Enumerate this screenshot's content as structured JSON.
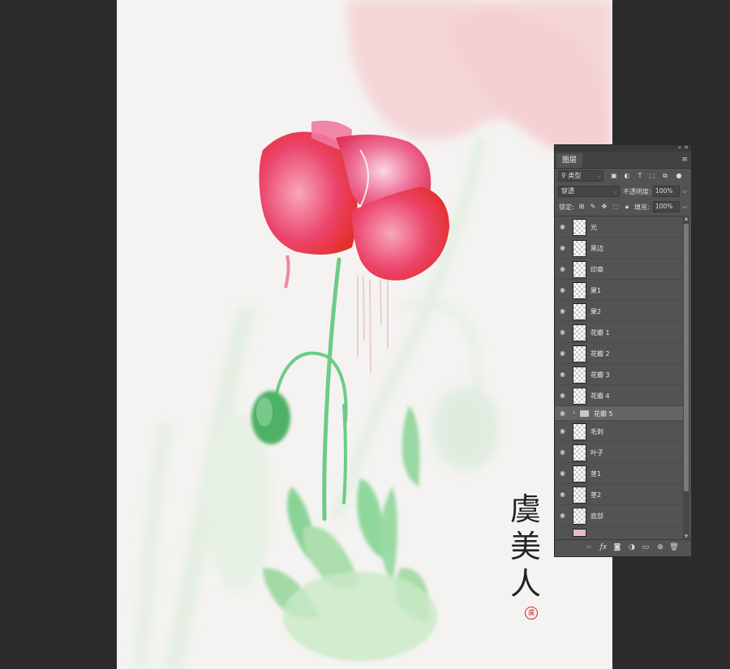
{
  "artwork": {
    "signature": "虞美人",
    "seal": "虞",
    "colors": {
      "paper": "#f4f3f1",
      "petal": "#e8436b",
      "petal_red": "#e8302f",
      "stem": "#6fd08a",
      "ghost_petal": "#f7d2d4"
    }
  },
  "layers_panel": {
    "tab": "图层",
    "collapse_icon": "double-chevron-icon",
    "close_icon": "close-icon",
    "menu_icon": "panel-menu-icon",
    "filter": {
      "kind": "类型",
      "icons": [
        "image-filter-icon",
        "adjustment-filter-icon",
        "type-filter-icon",
        "shape-filter-icon",
        "smart-object-filter-icon",
        "toggle-filter-icon"
      ]
    },
    "blend_mode": "穿透",
    "opacity_label": "不透明度:",
    "opacity_value": "100%",
    "lock_label": "锁定:",
    "fill_label": "填充:",
    "fill_value": "100%",
    "layers": [
      {
        "name": "光",
        "type": "layer",
        "visible": true
      },
      {
        "name": "黑边",
        "type": "layer",
        "visible": true
      },
      {
        "name": "印章",
        "type": "layer",
        "visible": true
      },
      {
        "name": "果1",
        "type": "layer",
        "visible": true
      },
      {
        "name": "果2",
        "type": "layer",
        "visible": true
      },
      {
        "name": "花瓣 1",
        "type": "layer",
        "visible": true
      },
      {
        "name": "花瓣 2",
        "type": "layer",
        "visible": true
      },
      {
        "name": "花瓣 3",
        "type": "layer",
        "visible": true
      },
      {
        "name": "花瓣 4",
        "type": "layer",
        "visible": true
      },
      {
        "name": "花瓣 5",
        "type": "group",
        "visible": true
      },
      {
        "name": "毛刺",
        "type": "layer",
        "visible": true
      },
      {
        "name": "叶子",
        "type": "layer",
        "visible": true
      },
      {
        "name": "茎1",
        "type": "layer",
        "visible": true
      },
      {
        "name": "茎2",
        "type": "layer",
        "visible": true
      },
      {
        "name": "底部",
        "type": "layer",
        "visible": true
      }
    ],
    "bottom_icons": [
      "link-layers-icon",
      "fx-icon",
      "mask-icon",
      "adjustment-icon",
      "new-group-icon",
      "new-layer-icon",
      "trash-icon"
    ]
  }
}
